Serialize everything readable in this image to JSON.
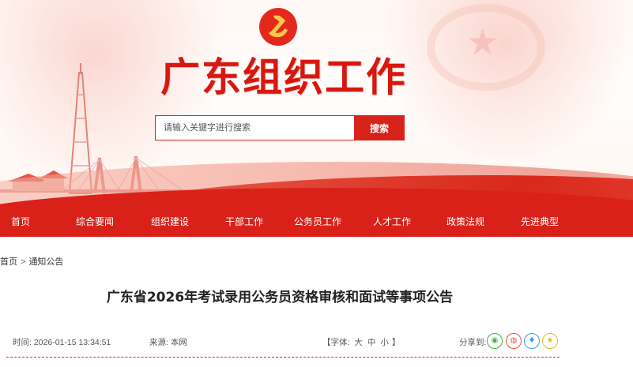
{
  "header": {
    "site_title": "广东组织工作",
    "search": {
      "placeholder": "请输入关键字进行搜索",
      "button_label": "搜索"
    }
  },
  "nav": {
    "items": [
      {
        "label": "首页"
      },
      {
        "label": "综合要闻"
      },
      {
        "label": "组织建设"
      },
      {
        "label": "干部工作"
      },
      {
        "label": "公务员工作"
      },
      {
        "label": "人才工作"
      },
      {
        "label": "政策法规"
      },
      {
        "label": "先进典型"
      }
    ]
  },
  "breadcrumb": {
    "home": "首页",
    "separator": ">",
    "current": "通知公告"
  },
  "article": {
    "title": "广东省2026年考试录用公务员资格审核和面试等事项公告",
    "time_label": "时间:",
    "time_value": "2026-01-15 13:34:51",
    "source_label": "来源:",
    "source_value": "本网",
    "font_size": {
      "open": "【字体:",
      "options": [
        "大",
        "中",
        "小"
      ],
      "close": "】"
    },
    "share_label": "分享到:"
  },
  "share_icons": [
    {
      "name": "wechat-icon",
      "color": "#3fb53b",
      "glyph": "◉"
    },
    {
      "name": "weibo-icon",
      "color": "#e8573c",
      "glyph": "◍"
    },
    {
      "name": "qq-icon",
      "color": "#3aa3e3",
      "glyph": "♦"
    },
    {
      "name": "qzone-icon",
      "color": "#f0b429",
      "glyph": "★"
    }
  ],
  "colors": {
    "brand_red": "#d9211a",
    "title_red": "#d8170f"
  }
}
